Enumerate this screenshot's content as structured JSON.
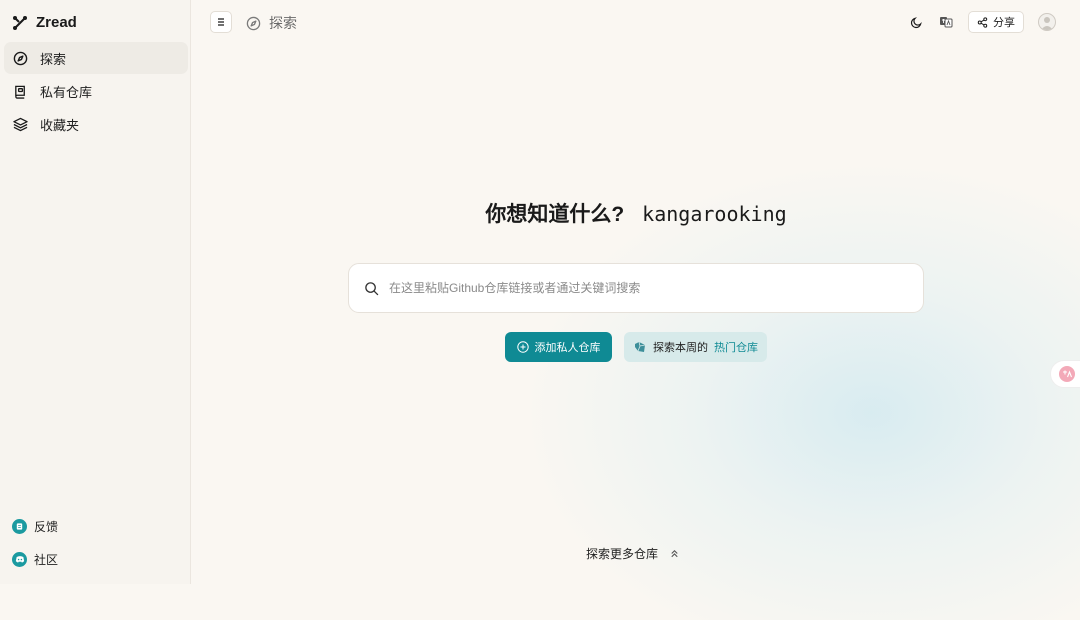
{
  "app": {
    "name": "Zread"
  },
  "sidebar": {
    "items": [
      {
        "label": "探索",
        "icon": "compass-icon",
        "active": true
      },
      {
        "label": "私有仓库",
        "icon": "private-repo-icon",
        "active": false
      },
      {
        "label": "收藏夹",
        "icon": "layers-icon",
        "active": false
      }
    ],
    "footer": [
      {
        "label": "反馈",
        "icon": "feedback-icon"
      },
      {
        "label": "社区",
        "icon": "discord-icon"
      }
    ]
  },
  "topbar": {
    "breadcrumb": "探索",
    "share_label": "分享"
  },
  "main": {
    "heading": "你想知道什么?",
    "username": "kangarooking",
    "search_placeholder": "在这里粘贴Github仓库链接或者通过关键词搜索",
    "add_private_label": "添加私人仓库",
    "explore_week_label": "探索本周的",
    "hot_repo_label": "热门仓库",
    "explore_more_label": "探索更多仓库"
  },
  "colors": {
    "accent": "#0f8a94",
    "background": "#faf7f2"
  }
}
